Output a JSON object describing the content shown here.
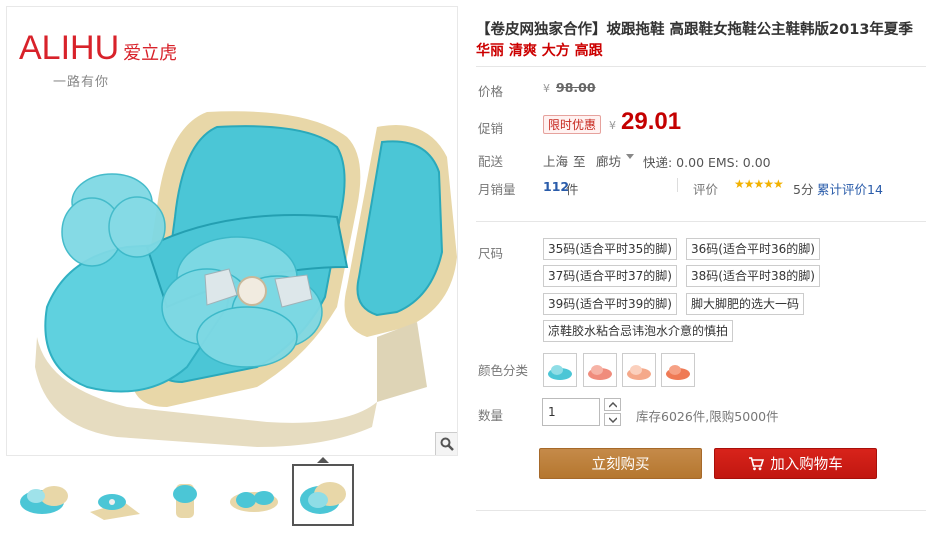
{
  "brand": {
    "name_en": "ALIHU",
    "name_cn": "爱立虎",
    "slogan": "一路有你"
  },
  "product": {
    "title": "【卷皮网独家合作】坡跟拖鞋 高跟鞋女拖鞋公主鞋韩版2013年夏季",
    "subtitle": "华丽 清爽 大方 高跟"
  },
  "price": {
    "label": "价格",
    "currency": "¥",
    "original": "98.00",
    "promo_label": "促销",
    "promo_badge": "限时优惠",
    "promo_price": "29.01"
  },
  "shipping": {
    "label": "配送",
    "from": "上海",
    "to_word": "至",
    "dest": "廊坊",
    "info": "快递: 0.00 EMS: 0.00"
  },
  "sales": {
    "label": "月销量",
    "count": "112",
    "unit": "件",
    "rating_label": "评价",
    "stars": "★★★★★",
    "score": "5分",
    "reviews": "累计评价14"
  },
  "size": {
    "label": "尺码",
    "options": [
      "35码(适合平时35的脚)",
      "36码(适合平时36的脚)",
      "37码(适合平时37的脚)",
      "38码(适合平时38的脚)",
      "39码(适合平时39的脚)",
      "脚大脚肥的选大一码",
      "凉鞋胶水粘合忌讳泡水介意的慎拍"
    ]
  },
  "color": {
    "label": "颜色分类",
    "swatches": [
      "#4bc6d6",
      "#f08c7c",
      "#f5a98a",
      "#ef7a55"
    ]
  },
  "quantity": {
    "label": "数量",
    "value": "1",
    "stock": "库存6026件,限购5000件"
  },
  "actions": {
    "buy": "立刻购买",
    "cart": "加入购物车"
  },
  "colors": {
    "accent": "#c40000",
    "link": "#2a5caa",
    "buy": "#b97b35",
    "cart": "#d01a13"
  }
}
